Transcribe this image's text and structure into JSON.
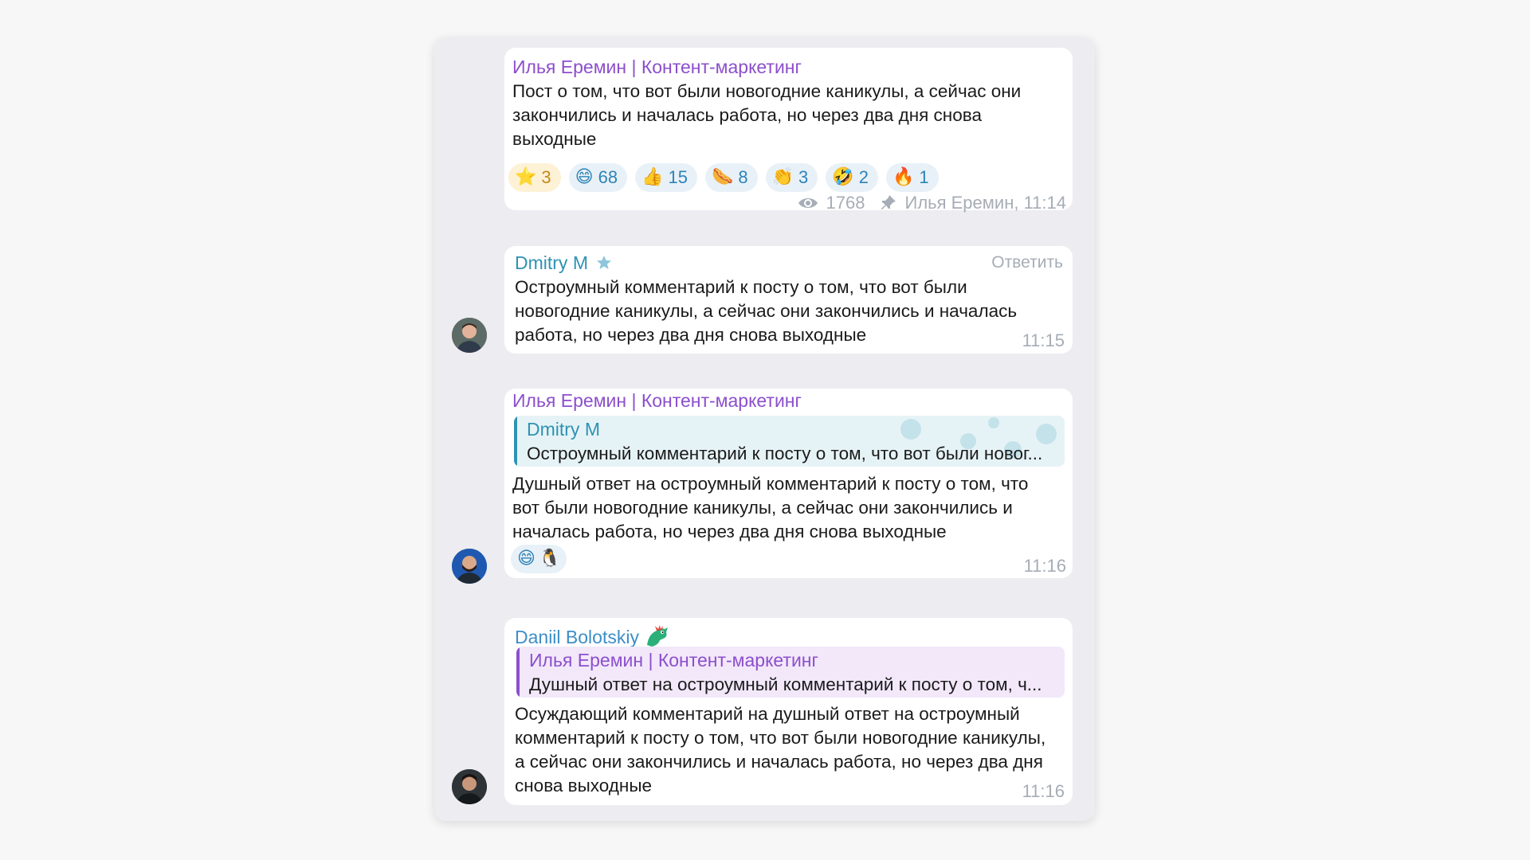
{
  "messages": [
    {
      "author": "Илья Еремин | Контент-маркетинг",
      "text": "Пост о том, что вот были новогодние каникулы, а сейчас они\nзакончились и началась работа, но через два дня снова\nвыходные",
      "reactions": [
        {
          "emoji": "⭐",
          "count": "3"
        },
        {
          "emoji": "😄",
          "count": "68"
        },
        {
          "emoji": "👍",
          "count": "15"
        },
        {
          "emoji": "🌭",
          "count": "8"
        },
        {
          "emoji": "👏",
          "count": "3"
        },
        {
          "emoji": "🤣",
          "count": "2"
        },
        {
          "emoji": "🔥",
          "count": "1"
        }
      ],
      "views": "1768",
      "signature": "Илья Еремин, 11:14"
    },
    {
      "author": "Dmitry M",
      "reply_link": "Ответить",
      "text": "Остроумный комментарий к посту о том, что вот были\nновогодние каникулы, а сейчас они закончились и началась\nработа, но через два дня снова выходные",
      "time": "11:15"
    },
    {
      "author": "Илья Еремин | Контент-маркетинг",
      "quote_author": "Dmitry M",
      "quote_text": "Остроумный комментарий к посту о том, что вот были новог...",
      "text": "Душный ответ на остроумный комментарий к посту о том, что\nвот были новогодние каникулы, а сейчас они закончились и\nначалась работа, но через два дня снова выходные",
      "reactions": [
        {
          "emoji": "😄"
        },
        {
          "emoji": "🐧"
        }
      ],
      "time": "11:16"
    },
    {
      "author": "Daniil Bolotskiy",
      "quote_author": "Илья Еремин | Контент-маркетинг",
      "quote_text": "Душный ответ на остроумный комментарий к посту о том, ч...",
      "text": "Осуждающий комментарий на душный ответ на остроумный\nкомментарий к посту о том, что вот были новогодние каникулы,\nа сейчас они закончились и началась работа, но через два дня\nснова выходные",
      "time": "11:16"
    }
  ],
  "colors": {
    "channel_name": "#8c4fcc",
    "dmitry_name": "#2e93b3",
    "daniil_name": "#3d8ec9",
    "meta_gray": "#a6adb6",
    "panel_bg": "#edecf1"
  },
  "icons": [
    "eye-icon",
    "pin-icon",
    "star-badge-icon",
    "dragon-emoji-icon"
  ]
}
